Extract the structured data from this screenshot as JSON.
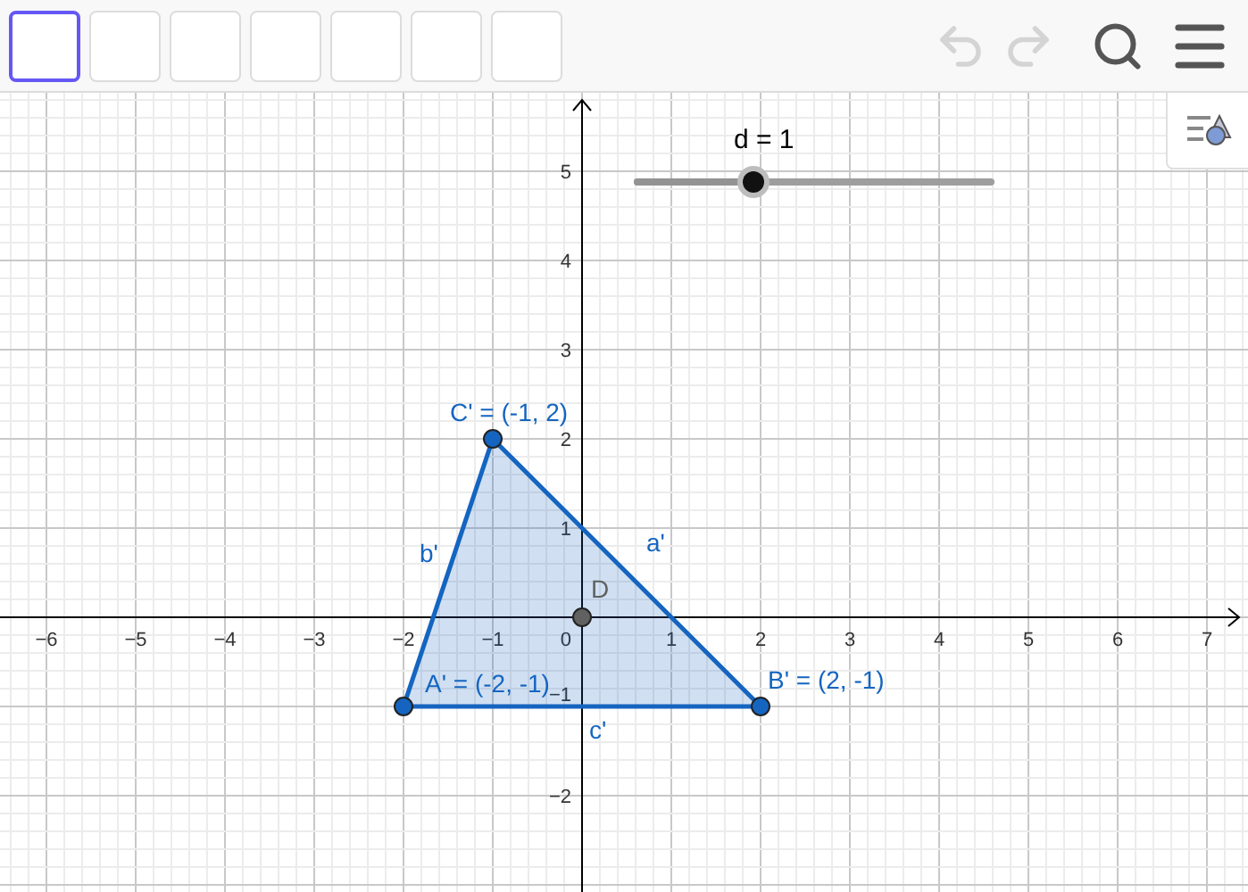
{
  "toolbar": {
    "tools": [
      {
        "selected": true
      },
      {
        "selected": false
      },
      {
        "selected": false
      },
      {
        "selected": false
      },
      {
        "selected": false
      },
      {
        "selected": false
      },
      {
        "selected": false
      }
    ],
    "undo": {
      "disabled": true
    },
    "redo": {
      "disabled": true
    }
  },
  "graphics": {
    "slider": {
      "label": "d = 1",
      "level": 0.33
    },
    "x_tick_labels": [
      "−6",
      "−5",
      "−4",
      "−3",
      "−2",
      "−1",
      "1",
      "2",
      "3",
      "4",
      "5",
      "6",
      "7"
    ],
    "origin_label": "0",
    "y_tick_labels": [
      "5",
      "4",
      "3",
      "2",
      "1",
      "−1",
      "−2"
    ],
    "polygon": {
      "color": "#1565c0"
    },
    "segments": [
      {
        "label": "a'"
      },
      {
        "label": "b'"
      },
      {
        "label": "c'"
      }
    ],
    "points": [
      {
        "label": "C' = (-1, 2)",
        "color": "#1565c0"
      },
      {
        "label": "A' = (-2, -1)",
        "color": "#1565c0"
      },
      {
        "label": "B' = (2, -1)",
        "color": "#1565c0"
      },
      {
        "label": "D",
        "color": "#616161"
      }
    ]
  }
}
